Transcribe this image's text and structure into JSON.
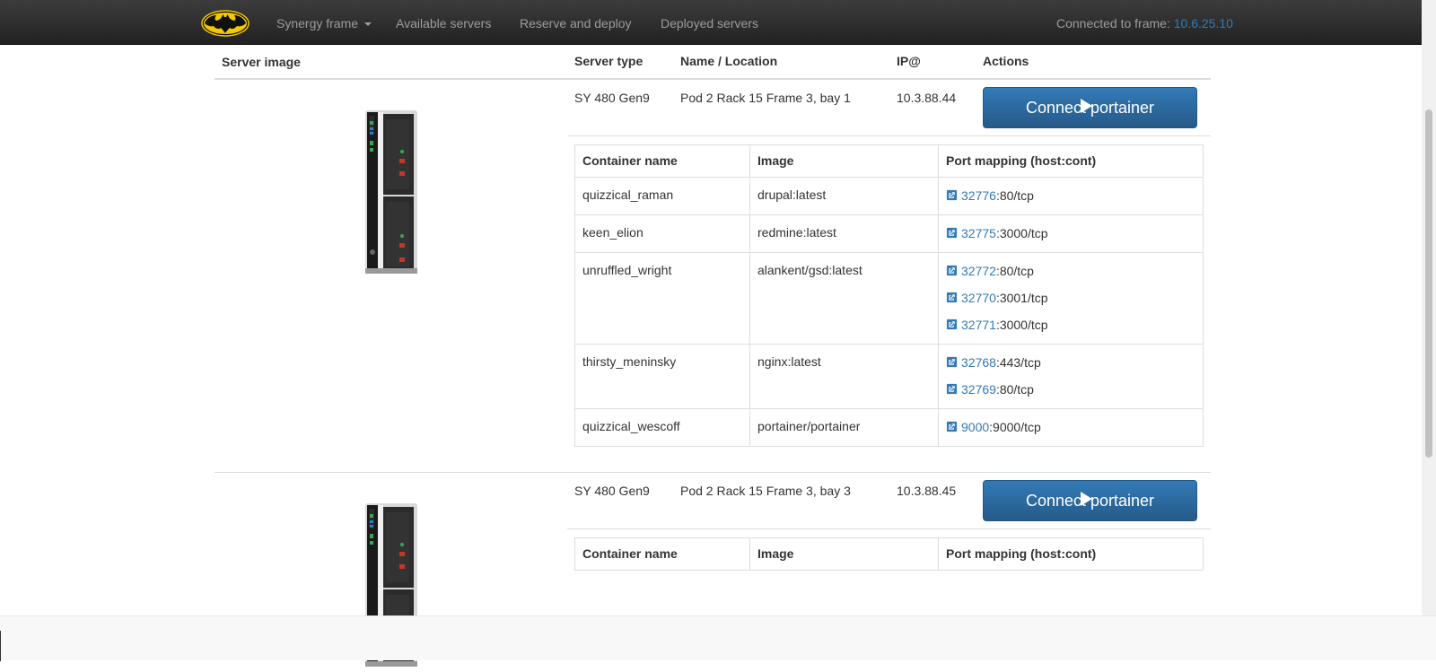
{
  "navbar": {
    "brand_icon": "batman-logo-icon",
    "items": [
      {
        "label": "Synergy frame",
        "dropdown": true
      },
      {
        "label": "Available servers"
      },
      {
        "label": "Reserve and deploy"
      },
      {
        "label": "Deployed servers"
      }
    ],
    "connected_label": "Connected to frame: ",
    "connected_ip": "10.6.25.10"
  },
  "table": {
    "headers": {
      "image": "Server image",
      "type": "Server type",
      "name": "Name / Location",
      "ip": "IP@",
      "actions": "Actions"
    },
    "servers": [
      {
        "type": "SY 480 Gen9",
        "name": "Pod 2 Rack 15 Frame 3, bay 1",
        "ip": "10.3.88.44",
        "action_label": "Connect portainer",
        "containers": [
          {
            "name": "quizzical_raman",
            "image": "drupal:latest",
            "ports": [
              {
                "host": "32776",
                "cont": ":80/tcp"
              }
            ]
          },
          {
            "name": "keen_elion",
            "image": "redmine:latest",
            "ports": [
              {
                "host": "32775",
                "cont": ":3000/tcp"
              }
            ]
          },
          {
            "name": "unruffled_wright",
            "image": "alankent/gsd:latest",
            "ports": [
              {
                "host": "32772",
                "cont": ":80/tcp"
              },
              {
                "host": "32770",
                "cont": ":3001/tcp"
              },
              {
                "host": "32771",
                "cont": ":3000/tcp"
              }
            ]
          },
          {
            "name": "thirsty_meninsky",
            "image": "nginx:latest",
            "ports": [
              {
                "host": "32768",
                "cont": ":443/tcp"
              },
              {
                "host": "32769",
                "cont": ":80/tcp"
              }
            ]
          },
          {
            "name": "quizzical_wescoff",
            "image": "portainer/portainer",
            "ports": [
              {
                "host": "9000",
                "cont": ":9000/tcp"
              }
            ]
          }
        ]
      },
      {
        "type": "SY 480 Gen9",
        "name": "Pod 2 Rack 15 Frame 3, bay 3",
        "ip": "10.3.88.45",
        "action_label": "Connect portainer",
        "containers": []
      }
    ],
    "container_headers": {
      "name": "Container name",
      "image": "Image",
      "ports": "Port mapping (host:cont)"
    }
  },
  "colors": {
    "navbar": "#222222",
    "link": "#337ab7",
    "button": "#2d6ca2"
  }
}
